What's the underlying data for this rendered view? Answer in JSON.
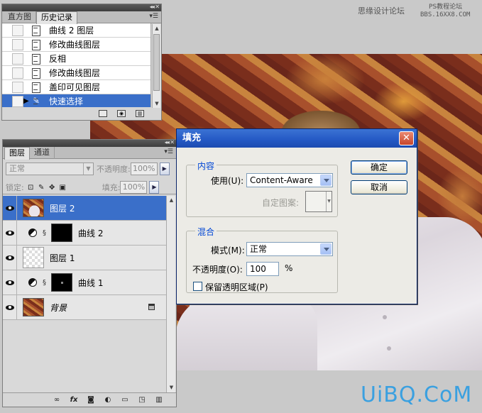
{
  "watermark": {
    "site": "思缘设计论坛",
    "site2": "PS教程论坛",
    "url": "BBS.16XX8.COM",
    "logo": "UiBQ.CoM"
  },
  "history_panel": {
    "tabs": [
      "直方图",
      "历史记录"
    ],
    "active_tab": "历史记录",
    "items": [
      {
        "label": "曲线 2 图层",
        "selected": false
      },
      {
        "label": "修改曲线图层",
        "selected": false
      },
      {
        "label": "反相",
        "selected": false
      },
      {
        "label": "修改曲线图层",
        "selected": false
      },
      {
        "label": "盖印可见图层",
        "selected": false
      },
      {
        "label": "快速选择",
        "selected": true
      }
    ],
    "menu_icon": "panel-menu-icon"
  },
  "layers_panel": {
    "tabs": [
      "图层",
      "通道"
    ],
    "blend_mode": "正常",
    "opacity_label": "不透明度:",
    "opacity_value": "100%",
    "lock_label": "锁定:",
    "fill_label": "填充:",
    "fill_value": "100%",
    "layers": [
      {
        "name": "图层 2",
        "type": "image",
        "selected": true
      },
      {
        "name": "曲线 2",
        "type": "adjustment",
        "selected": false
      },
      {
        "name": "图层 1",
        "type": "transparent",
        "selected": false
      },
      {
        "name": "曲线 1",
        "type": "adjustment",
        "selected": false
      },
      {
        "name": "背景",
        "type": "background",
        "selected": false,
        "locked": true
      }
    ],
    "footer_icons": [
      "link-icon",
      "fx-icon",
      "mask-icon",
      "adjustment-icon",
      "group-folder-icon",
      "new-layer-icon",
      "trash-icon"
    ]
  },
  "fill_dialog": {
    "title": "填充",
    "contents_group": "内容",
    "use_label": "使用(U):",
    "use_value": "Content-Aware",
    "custom_pattern_label": "自定图案:",
    "blending_group": "混合",
    "mode_label": "模式(M):",
    "mode_value": "正常",
    "opacity_label": "不透明度(O):",
    "opacity_value": "100",
    "opacity_unit": "%",
    "preserve_transparency_label": "保留透明区域(P)",
    "preserve_transparency_checked": false,
    "ok_label": "确定",
    "cancel_label": "取消",
    "close_symbol": "✕"
  }
}
